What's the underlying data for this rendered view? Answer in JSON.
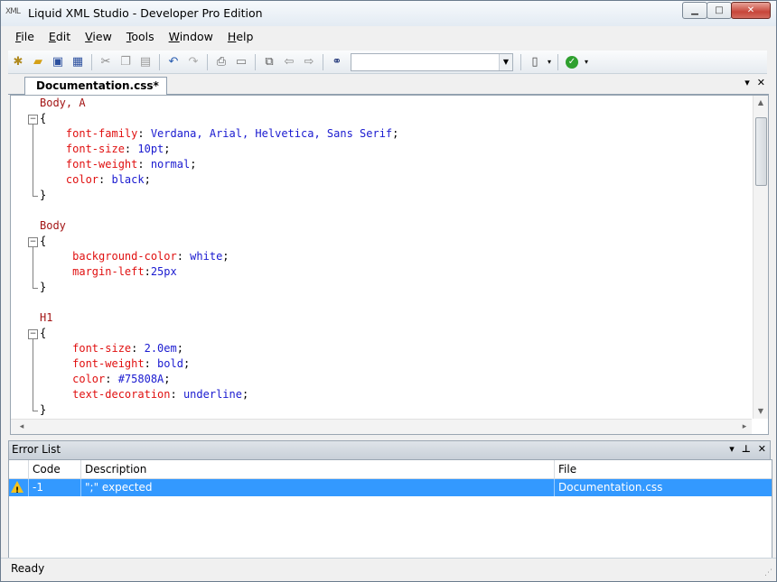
{
  "window": {
    "title": "Liquid XML Studio - Developer Pro Edition",
    "icon_label": "XML"
  },
  "menu": {
    "items": [
      {
        "label": "File",
        "hot": "F",
        "rest": "ile"
      },
      {
        "label": "Edit",
        "hot": "E",
        "rest": "dit"
      },
      {
        "label": "View",
        "hot": "V",
        "rest": "iew"
      },
      {
        "label": "Tools",
        "hot": "T",
        "rest": "ools"
      },
      {
        "label": "Window",
        "hot": "W",
        "rest": "indow"
      },
      {
        "label": "Help",
        "hot": "H",
        "rest": "elp"
      }
    ]
  },
  "toolbar": {
    "search_value": ""
  },
  "editor": {
    "tab_label": "Documentation.css*",
    "lines": [
      [
        {
          "t": "Body, A",
          "c": "sel"
        }
      ],
      [
        {
          "t": "{",
          "c": "brace"
        }
      ],
      [
        {
          "t": "    font-family",
          "c": "prop"
        },
        {
          "t": ": ",
          "c": "punct"
        },
        {
          "t": "Verdana, Arial, Helvetica, Sans Serif",
          "c": "val"
        },
        {
          "t": ";",
          "c": "punct"
        }
      ],
      [
        {
          "t": "    font-size",
          "c": "prop"
        },
        {
          "t": ": ",
          "c": "punct"
        },
        {
          "t": "10pt",
          "c": "val"
        },
        {
          "t": ";",
          "c": "punct"
        }
      ],
      [
        {
          "t": "    font-weight",
          "c": "prop"
        },
        {
          "t": ": ",
          "c": "punct"
        },
        {
          "t": "normal",
          "c": "val"
        },
        {
          "t": ";",
          "c": "punct"
        }
      ],
      [
        {
          "t": "    color",
          "c": "prop"
        },
        {
          "t": ": ",
          "c": "punct"
        },
        {
          "t": "black",
          "c": "val"
        },
        {
          "t": ";",
          "c": "punct"
        }
      ],
      [
        {
          "t": "}",
          "c": "brace"
        }
      ],
      [],
      [
        {
          "t": "Body",
          "c": "sel"
        }
      ],
      [
        {
          "t": "{",
          "c": "brace"
        }
      ],
      [
        {
          "t": "     background-color",
          "c": "prop"
        },
        {
          "t": ": ",
          "c": "punct"
        },
        {
          "t": "white",
          "c": "val"
        },
        {
          "t": ";",
          "c": "punct"
        }
      ],
      [
        {
          "t": "     margin-left",
          "c": "prop"
        },
        {
          "t": ":",
          "c": "punct"
        },
        {
          "t": "25px",
          "c": "val"
        }
      ],
      [
        {
          "t": "}",
          "c": "brace"
        }
      ],
      [],
      [
        {
          "t": "H1",
          "c": "sel"
        }
      ],
      [
        {
          "t": "{",
          "c": "brace"
        }
      ],
      [
        {
          "t": "     font-size",
          "c": "prop"
        },
        {
          "t": ": ",
          "c": "punct"
        },
        {
          "t": "2.0em",
          "c": "val"
        },
        {
          "t": ";",
          "c": "punct"
        }
      ],
      [
        {
          "t": "     font-weight",
          "c": "prop"
        },
        {
          "t": ": ",
          "c": "punct"
        },
        {
          "t": "bold",
          "c": "val"
        },
        {
          "t": ";",
          "c": "punct"
        }
      ],
      [
        {
          "t": "     color",
          "c": "prop"
        },
        {
          "t": ": ",
          "c": "punct"
        },
        {
          "t": "#75808A",
          "c": "val"
        },
        {
          "t": ";",
          "c": "punct"
        }
      ],
      [
        {
          "t": "     text-decoration",
          "c": "prop"
        },
        {
          "t": ": ",
          "c": "punct"
        },
        {
          "t": "underline",
          "c": "val"
        },
        {
          "t": ";",
          "c": "punct"
        }
      ],
      [
        {
          "t": "}",
          "c": "brace"
        }
      ]
    ]
  },
  "error_list": {
    "title": "Error List",
    "columns": {
      "code": "Code",
      "description": "Description",
      "file": "File"
    },
    "rows": [
      {
        "code": "-1",
        "description": "\";\" expected",
        "file": "Documentation.css",
        "level": "warning-icon"
      }
    ]
  },
  "status": {
    "text": "Ready"
  },
  "colors": {
    "selected_row": "#3399ff",
    "selector": "#a31515",
    "property": "#e01010",
    "value": "#1a1ad0"
  }
}
